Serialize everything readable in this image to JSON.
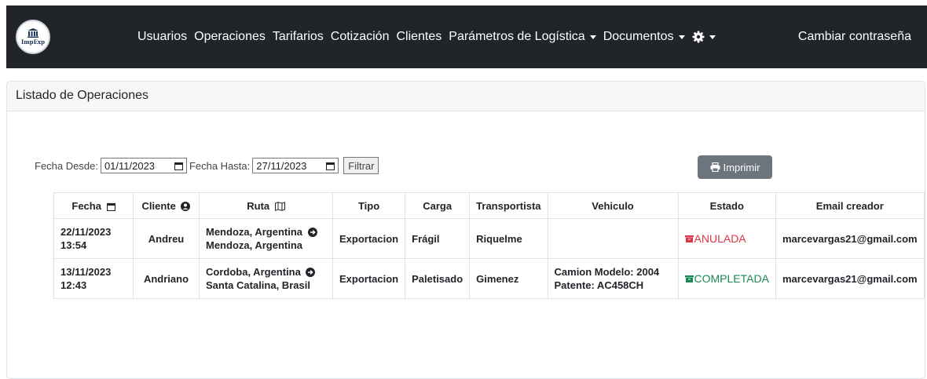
{
  "navbar": {
    "logo_text": "ImpExp",
    "links": [
      "Usuarios",
      "Operaciones",
      "Tarifarios",
      "Cotización",
      "Clientes"
    ],
    "dropdowns": [
      "Parámetros de Logística",
      "Documentos"
    ],
    "gear_icon": "gear-icon",
    "right_link": "Cambiar contraseña"
  },
  "card": {
    "title": "Listado de Operaciones"
  },
  "filters": {
    "desde_label": "Fecha Desde:",
    "desde_value": "01/11/2023",
    "hasta_label": "Fecha Hasta:",
    "hasta_value": "27/11/2023",
    "filter_button": "Filtrar"
  },
  "print_button": "Imprimir",
  "table": {
    "headers": [
      "Fecha",
      "Cliente",
      "Ruta",
      "Tipo",
      "Carga",
      "Transportista",
      "Vehiculo",
      "Estado",
      "Email creador"
    ],
    "rows": [
      {
        "fecha_1": "22/11/2023",
        "fecha_2": "13:54",
        "cliente": "Andreu",
        "ruta_1": "Mendoza, Argentina",
        "ruta_2": "Mendoza, Argentina",
        "tipo": "Exportacion",
        "carga": "Frágil",
        "transportista": "Riquelme",
        "vehiculo_1": "",
        "vehiculo_2": "",
        "estado": "ANULADA",
        "estado_color": "#dc3545",
        "email": "marcevargas21@gmail.com"
      },
      {
        "fecha_1": "13/11/2023",
        "fecha_2": "12:43",
        "cliente": "Andriano",
        "ruta_1": "Cordoba, Argentina",
        "ruta_2": "Santa Catalina, Brasil",
        "tipo": "Exportacion",
        "carga": "Paletisado",
        "transportista": "Gimenez",
        "vehiculo_1": "Camion Modelo: 2004",
        "vehiculo_2": "Patente: AC458CH",
        "estado": "COMPLETADA",
        "estado_color": "#198754",
        "email": "marcevargas21@gmail.com"
      }
    ]
  },
  "colors": {
    "navbar": "#212529",
    "print_button": "#6c757d",
    "anulada": "#dc3545",
    "completada": "#198754"
  }
}
